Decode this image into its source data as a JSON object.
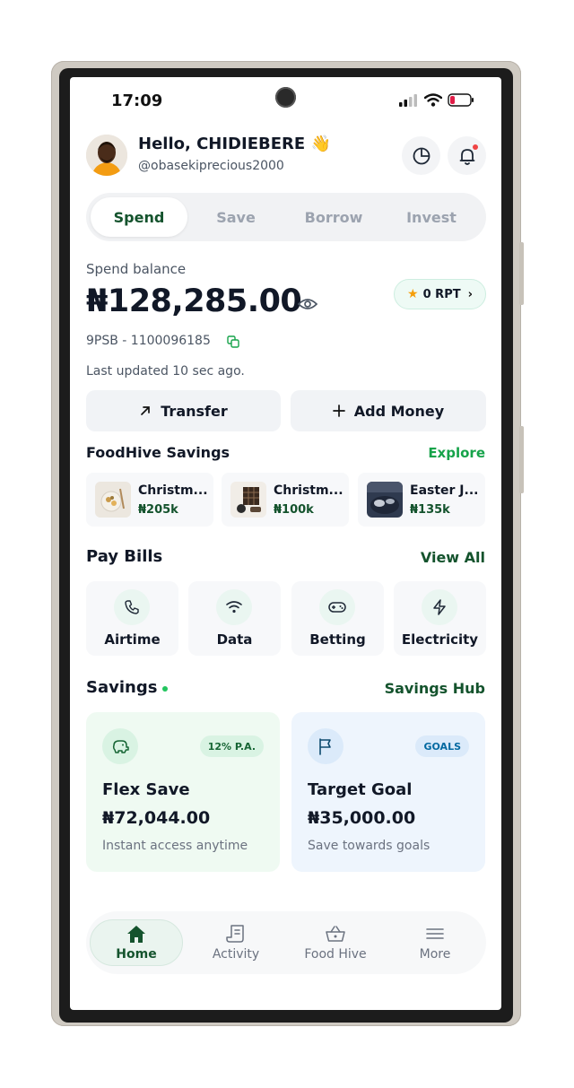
{
  "status_bar": {
    "time": "17:09"
  },
  "header": {
    "greeting": "Hello, CHIDIEBERE",
    "wave_emoji": "👋",
    "handle": "@obasekiprecious2000",
    "icons": [
      "pie-chart-icon",
      "bell-icon"
    ]
  },
  "tabs": [
    {
      "label": "Spend",
      "active": true
    },
    {
      "label": "Save",
      "active": false
    },
    {
      "label": "Borrow",
      "active": false
    },
    {
      "label": "Invest",
      "active": false
    }
  ],
  "balance": {
    "label": "Spend balance",
    "amount": "₦128,285.00",
    "account": "9PSB - 1100096185",
    "updated": "Last updated 10 sec ago.",
    "rpt": "0 RPT"
  },
  "actions": {
    "transfer": "Transfer",
    "add_money": "Add Money"
  },
  "foodhive": {
    "title": "FoodHive Savings",
    "link": "Explore",
    "items": [
      {
        "name": "Christm...",
        "amount": "₦205k"
      },
      {
        "name": "Christm...",
        "amount": "₦100k"
      },
      {
        "name": "Easter J...",
        "amount": "₦135k"
      }
    ]
  },
  "bills": {
    "title": "Pay Bills",
    "link": "View All",
    "items": [
      {
        "label": "Airtime",
        "icon": "phone-icon"
      },
      {
        "label": "Data",
        "icon": "wifi-icon"
      },
      {
        "label": "Betting",
        "icon": "gamepad-icon"
      },
      {
        "label": "Electricity",
        "icon": "bolt-icon"
      }
    ]
  },
  "savings": {
    "title": "Savings",
    "link": "Savings Hub",
    "cards": [
      {
        "badge": "12% P.A.",
        "title": "Flex Save",
        "amount": "₦72,044.00",
        "subtitle": "Instant access anytime",
        "icon": "piggy-bank-icon"
      },
      {
        "badge": "GOALS",
        "title": "Target Goal",
        "amount": "₦35,000.00",
        "subtitle": "Save towards goals",
        "icon": "flag-icon"
      }
    ]
  },
  "bottom_nav": [
    {
      "label": "Home",
      "icon": "home-icon",
      "active": true
    },
    {
      "label": "Activity",
      "icon": "receipt-icon",
      "active": false
    },
    {
      "label": "Food Hive",
      "icon": "basket-icon",
      "active": false
    },
    {
      "label": "More",
      "icon": "menu-icon",
      "active": false
    }
  ],
  "colors": {
    "brand_green": "#14532d",
    "accent_green": "#16a34a",
    "flex_card_bg": "#effaf2",
    "goal_card_bg": "#eef5fd",
    "goal_blue": "#0369a1"
  }
}
